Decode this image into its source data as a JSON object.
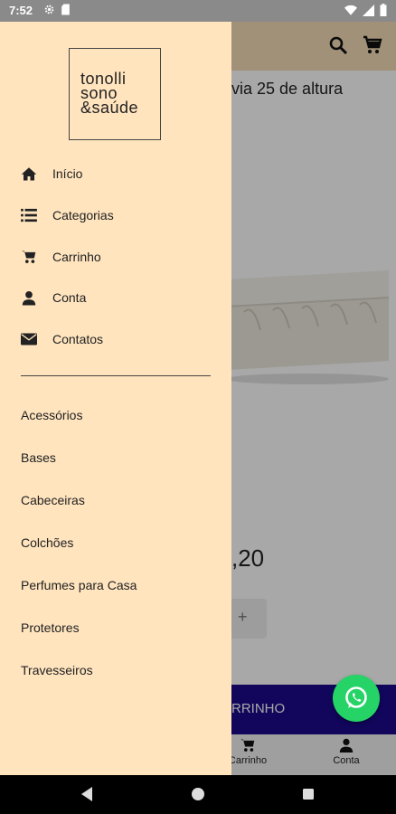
{
  "status": {
    "time": "7:52"
  },
  "background": {
    "product_title": "via 25 de altura",
    "price": ",20",
    "stepper_plus": "+",
    "cart_label": "RRINHO",
    "bottom_nav": {
      "cart_label": "Carrinho",
      "account_label": "Conta"
    }
  },
  "drawer": {
    "logo_lines": [
      "tonolli",
      "sono",
      "&saúde"
    ],
    "menu": [
      {
        "label": "Início",
        "icon": "home-icon"
      },
      {
        "label": "Categorias",
        "icon": "list-icon"
      },
      {
        "label": "Carrinho",
        "icon": "cart-icon"
      },
      {
        "label": "Conta",
        "icon": "user-icon"
      },
      {
        "label": "Contatos",
        "icon": "envelope-icon"
      }
    ],
    "categories": [
      "Acessórios",
      "Bases",
      "Cabeceiras",
      "Colchões",
      "Perfumes para Casa",
      "Protetores",
      "Travesseiros"
    ]
  },
  "colors": {
    "drawer_bg": "#ffe4be",
    "appbar_bg": "#f5ddb6",
    "cart_bar": "#1a0a8c",
    "whatsapp": "#25d366"
  }
}
